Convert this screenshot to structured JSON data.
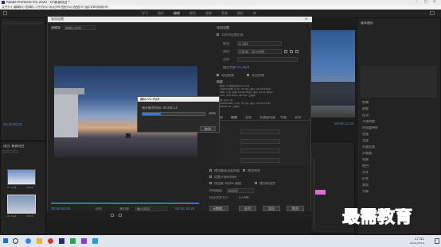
{
  "window": {
    "title": "Adobe Premiere Pro 2020 - D:\\新建项目 *"
  },
  "menu": [
    "文件(F)",
    "编辑(E)",
    "剪辑(C)",
    "序列(S)",
    "标记(M)",
    "图形(G)",
    "视图(V)",
    "窗口(W)",
    "帮助(H)"
  ],
  "workspace_tabs": [
    "学习",
    "组件",
    "编辑",
    "颜色",
    "效果",
    "音频",
    "图形",
    "库"
  ],
  "export_dialog": {
    "title": "导出设置",
    "source_label": "源缩放",
    "source_value": "缩放以适合",
    "export_settings_title": "导出设置",
    "match_sequence": "与序列设置匹配",
    "rows": [
      {
        "label": "格式:",
        "value": "H.264"
      },
      {
        "label": "预设:",
        "value": "匹配源 - 高比特率"
      },
      {
        "label": "注释:",
        "value": ""
      },
      {
        "label": "输出名称:",
        "value": "01.mp4"
      }
    ],
    "export_video": "导出视频",
    "export_audio": "导出音频",
    "summary_title": "摘要",
    "summary_lines": [
      "输出: D:\\新建项目\\01.mp4",
      "1920x1080 (1.0), 25 fps, 逐行, 00:00:18:20",
      "VBR, 1 次, 目标 10.00 Mbps, 最大 12.00 Mbps",
      "AAC, 320 kbps, 48 kHz, 立体声",
      "源: 序列, 01",
      "1920x1080 (1.0), 25 fps, 逐行, 00:00:18:20",
      "48000 Hz, 立体声"
    ],
    "tabs": [
      "效果",
      "视频",
      "音频",
      "多路复用器",
      "字幕",
      "发布"
    ],
    "bottom_checks": [
      "使用最高渲染质量",
      "使用预览",
      "设置开始时间码",
      "仅渲染 Alpha 通道",
      "使用帧混合",
      "导入项目中"
    ],
    "time_interp_label": "时间插值",
    "time_interp_value": "帧采样",
    "file_size_label": "估计文件大小",
    "file_size_value": "23 MB",
    "buttons": [
      "元数据...",
      "队列",
      "导出",
      "取消"
    ],
    "timecode_left": "00:00:00:00",
    "timecode_right": "00:00:18:20",
    "fit_label": "适合",
    "range_label": "源范围",
    "range_value": "整个序列"
  },
  "encode_dialog": {
    "title": "编码 01.mp4",
    "remaining": "预计剩余时间: 00:00:13",
    "percent": "30%",
    "progress": 0.3,
    "cancel": "取消"
  },
  "left_panel": {
    "timecode": "00;00;00;00",
    "project_tab": "项目: 新建项目",
    "clips": [
      {
        "name": "01.mp4",
        "duration": "18:20"
      },
      {
        "name": "01.mp4",
        "duration": "18:20"
      }
    ]
  },
  "right_panel": {
    "title": "基本图形",
    "timecode": "00:00:12:20",
    "items": [
      "剪辑",
      "视频",
      "运动",
      "不透明度",
      "时间重映射",
      "音频",
      "音量",
      "声道音量",
      "声像器",
      "效果",
      "颜色",
      "文本",
      "形状",
      "蒙版",
      "字幕"
    ]
  },
  "watermark": "最需教育",
  "taskbar": {
    "time": "17:41",
    "date": "2021/9/14"
  }
}
